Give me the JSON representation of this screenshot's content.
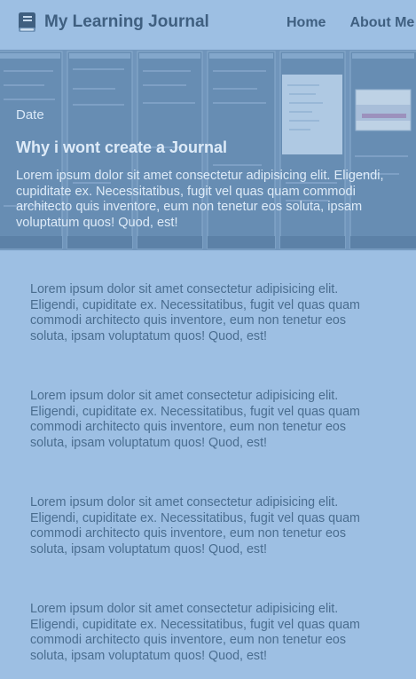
{
  "header": {
    "brand_icon": "book-icon",
    "brand_title": "My Learning Journal",
    "nav": [
      {
        "label": "Home"
      },
      {
        "label": "About Me"
      }
    ]
  },
  "hero": {
    "date": "Date",
    "title": "Why i wont create a Journal",
    "text": "Lorem ipsum dolor sit amet consectetur adipisicing elit. Eligendi, cupiditate ex. Necessitatibus, fugit vel quas quam commodi architecto quis inventore, eum non tenetur eos soluta, ipsam voluptatum quos! Quod, est!"
  },
  "posts": [
    {
      "text": "Lorem ipsum dolor sit amet consectetur adipisicing elit. Eligendi, cupiditate ex. Necessitatibus, fugit vel quas quam commodi architecto quis inventore, eum non tenetur eos soluta, ipsam voluptatum quos! Quod, est!"
    },
    {
      "text": "Lorem ipsum dolor sit amet consectetur adipisicing elit. Eligendi, cupiditate ex. Necessitatibus, fugit vel quas quam commodi architecto quis inventore, eum non tenetur eos soluta, ipsam voluptatum quos! Quod, est!"
    },
    {
      "text": "Lorem ipsum dolor sit amet consectetur adipisicing elit. Eligendi, cupiditate ex. Necessitatibus, fugit vel quas quam commodi architecto quis inventore, eum non tenetur eos soluta, ipsam voluptatum quos! Quod, est!"
    },
    {
      "text": "Lorem ipsum dolor sit amet consectetur adipisicing elit. Eligendi, cupiditate ex. Necessitatibus, fugit vel quas quam commodi architecto quis inventore, eum non tenetur eos soluta, ipsam voluptatum quos! Quod, est!"
    }
  ],
  "colors": {
    "page_background": "#9dbfe3",
    "header_text": "#3f5f80",
    "body_text": "#4a6d8f",
    "hero_text": "#deebf8"
  }
}
